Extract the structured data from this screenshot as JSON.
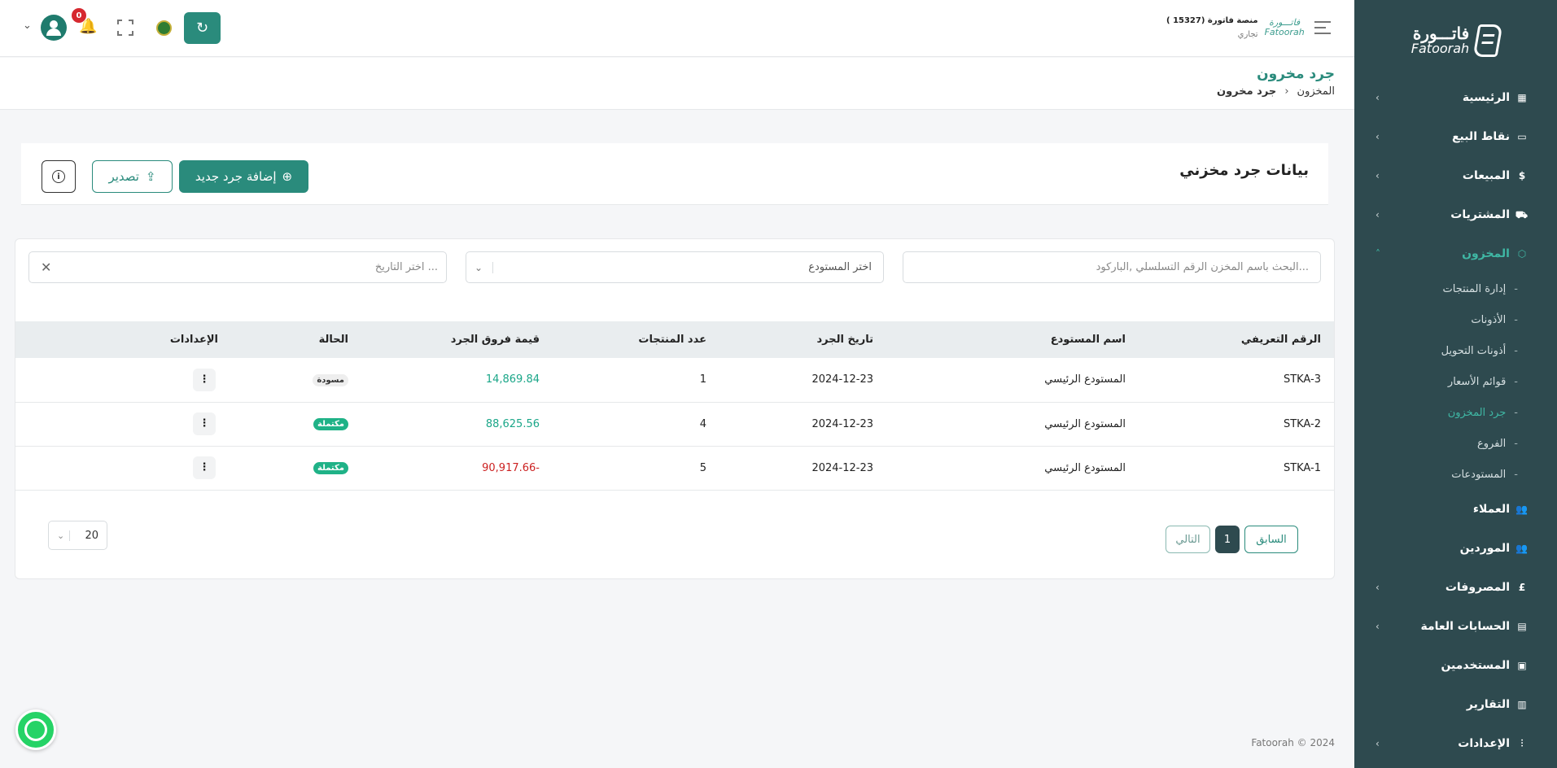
{
  "sidebar": {
    "logo_ar": "فاتـــورة",
    "logo_en": "Fatoorah",
    "items": [
      {
        "label": "الرئيسية",
        "icon": "grid-icon",
        "glyph": "▦",
        "chevron": "‹"
      },
      {
        "label": "نقاط البيع",
        "icon": "monitor-icon",
        "glyph": "▭",
        "chevron": "‹"
      },
      {
        "label": "المبيعات",
        "icon": "dollar-icon",
        "glyph": "$",
        "chevron": "‹"
      },
      {
        "label": "المشتريات",
        "icon": "basket-icon",
        "glyph": "⛟",
        "chevron": "‹"
      },
      {
        "label": "المخزون",
        "icon": "box-icon",
        "glyph": "⬡",
        "chevron": "˄"
      }
    ],
    "sub_items": [
      "إدارة المنتجات",
      "الأذونات",
      "أذونات التحويل",
      "قوائم الأسعار",
      "جرد المخزون",
      "الفروع",
      "المستودعات"
    ],
    "sub_dash": "-",
    "items_after": [
      {
        "label": "العملاء",
        "icon": "users-icon",
        "glyph": "👥",
        "chevron": ""
      },
      {
        "label": "الموردين",
        "icon": "suppliers-icon",
        "glyph": "👥",
        "chevron": ""
      },
      {
        "label": "المصروفات",
        "icon": "expense-icon",
        "glyph": "£",
        "chevron": "‹"
      },
      {
        "label": "الحسابات العامة",
        "icon": "calculator-icon",
        "glyph": "▤",
        "chevron": "‹"
      },
      {
        "label": "المستخدمين",
        "icon": "user-card-icon",
        "glyph": "▣",
        "chevron": ""
      },
      {
        "label": "التقارير",
        "icon": "chart-icon",
        "glyph": "▥",
        "chevron": ""
      },
      {
        "label": "الإعدادات",
        "icon": "sliders-icon",
        "glyph": "⫶",
        "chevron": "‹"
      }
    ]
  },
  "topbar": {
    "org_logo_ar": "فاتـــورة",
    "org_logo_en": "Fatoorah",
    "org_name": "منصة فاتورة",
    "org_id": "(15327 )",
    "org_type": "تجاري",
    "notifications_count": "0",
    "refresh_glyph": "↻",
    "bell_glyph": "🔔",
    "user_chevron": "⌄"
  },
  "page": {
    "title": "جرد مخرون",
    "breadcrumb_parent": "المخزون",
    "breadcrumb_sep": "‹",
    "breadcrumb_current": "جرد مخرون"
  },
  "card": {
    "title": "بيانات جرد مخزني",
    "add_label": "إضافة جرد جديد",
    "add_glyph": "⊕",
    "export_label": "تصدير",
    "export_glyph": "⇪",
    "info_glyph": "i"
  },
  "filters": {
    "search_placeholder": "البحث باسم المخزن الرقم التسلسلي ,الباركود...",
    "warehouse_placeholder": "اختر المستودع",
    "date_placeholder": "اختر التاريخ ...",
    "caret_glyph": "⌄",
    "clear_glyph": "✕"
  },
  "table": {
    "headers": [
      "الرقم التعريفي",
      "اسم المستودع",
      "تاريخ الجرد",
      "عدد المنتجات",
      "قيمة فروق الجرد",
      "الحالة",
      "الإعدادات"
    ],
    "rows": [
      {
        "id": "STKA-3",
        "warehouse": "المستودع الرئيسي",
        "date": "2024-12-23",
        "count": "1",
        "value": "14,869.84",
        "value_sign": "pos",
        "status": "مسودة",
        "status_kind": "draft"
      },
      {
        "id": "STKA-2",
        "warehouse": "المستودع الرئيسي",
        "date": "2024-12-23",
        "count": "4",
        "value": "88,625.56",
        "value_sign": "pos",
        "status": "مكتملة",
        "status_kind": "done"
      },
      {
        "id": "STKA-1",
        "warehouse": "المستودع الرئيسي",
        "date": "2024-12-23",
        "count": "5",
        "value": "-90,917.66",
        "value_sign": "neg",
        "status": "مكتملة",
        "status_kind": "done"
      }
    ],
    "menu_glyph": "⋮"
  },
  "pagination": {
    "prev": "السابق",
    "current": "1",
    "next": "التالي",
    "page_size": "20",
    "caret_glyph": "⌄"
  },
  "footer": "Fatoorah © 2024"
}
